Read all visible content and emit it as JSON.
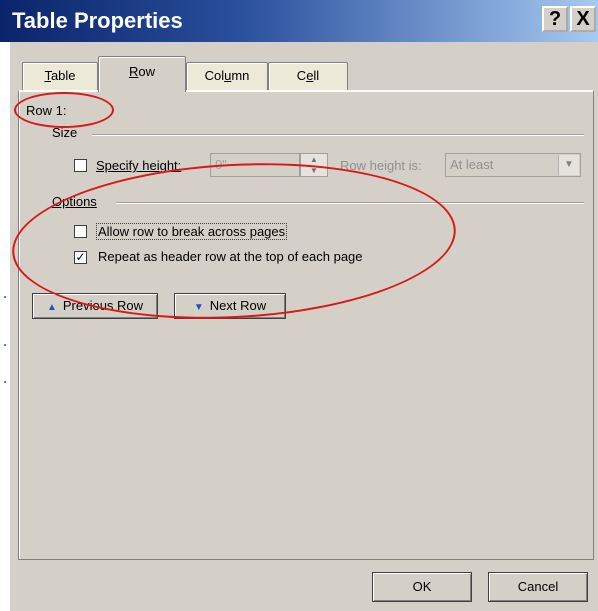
{
  "window": {
    "title": "Table Properties",
    "help_label": "?",
    "close_label": "X"
  },
  "tabs": [
    {
      "label": "Table",
      "mnemonic": "T",
      "rest": "able",
      "active": false
    },
    {
      "label": "Row",
      "mnemonic": "R",
      "rest": "ow",
      "active": true
    },
    {
      "label": "Column",
      "pre": "Col",
      "mnemonic": "u",
      "rest": "mn",
      "active": false
    },
    {
      "label": "Cell",
      "pre": "C",
      "mnemonic": "e",
      "rest": "ll",
      "active": false
    }
  ],
  "row_panel": {
    "row_label": "Row 1:",
    "size": {
      "heading": "Size",
      "specify_height_label": "Specify height:",
      "specify_height_checked": false,
      "height_value": "0\"",
      "row_height_is_label": "Row height is:",
      "row_height_is_value": "At least"
    },
    "options": {
      "heading": "Options",
      "allow_break_label": "Allow row to break across pages",
      "allow_break_checked": false,
      "repeat_header_label": "Repeat as header row at the top of each page",
      "repeat_header_checked": true
    },
    "previous_row_label": "Previous Row",
    "next_row_label": "Next Row"
  },
  "footer": {
    "ok_label": "OK",
    "cancel_label": "Cancel"
  },
  "annotation_color": "#d91818"
}
